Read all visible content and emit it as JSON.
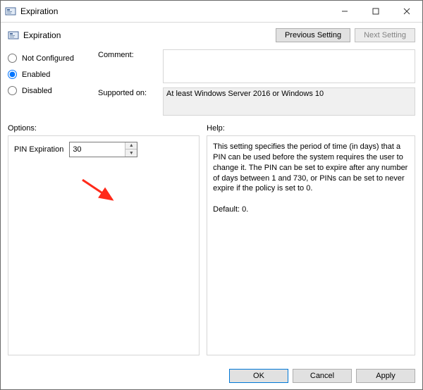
{
  "window": {
    "title": "Expiration"
  },
  "header": {
    "title": "Expiration",
    "previous_setting": "Previous Setting",
    "next_setting": "Next Setting"
  },
  "state": {
    "not_configured": "Not Configured",
    "enabled": "Enabled",
    "disabled": "Disabled",
    "selected": "enabled"
  },
  "comment": {
    "label": "Comment:",
    "value": ""
  },
  "supported": {
    "label": "Supported on:",
    "value": "At least Windows Server 2016 or Windows 10"
  },
  "options": {
    "label": "Options:",
    "pin_expiration_label": "PIN Expiration",
    "pin_expiration_value": "30"
  },
  "help": {
    "label": "Help:",
    "body": "This setting specifies the period of time (in days) that a PIN can be used before the system requires the user to change it. The PIN can be set to expire after any number of days between 1 and 730, or PINs can be set to never expire if the policy is set to 0.",
    "default_line": "Default: 0."
  },
  "buttons": {
    "ok": "OK",
    "cancel": "Cancel",
    "apply": "Apply"
  }
}
